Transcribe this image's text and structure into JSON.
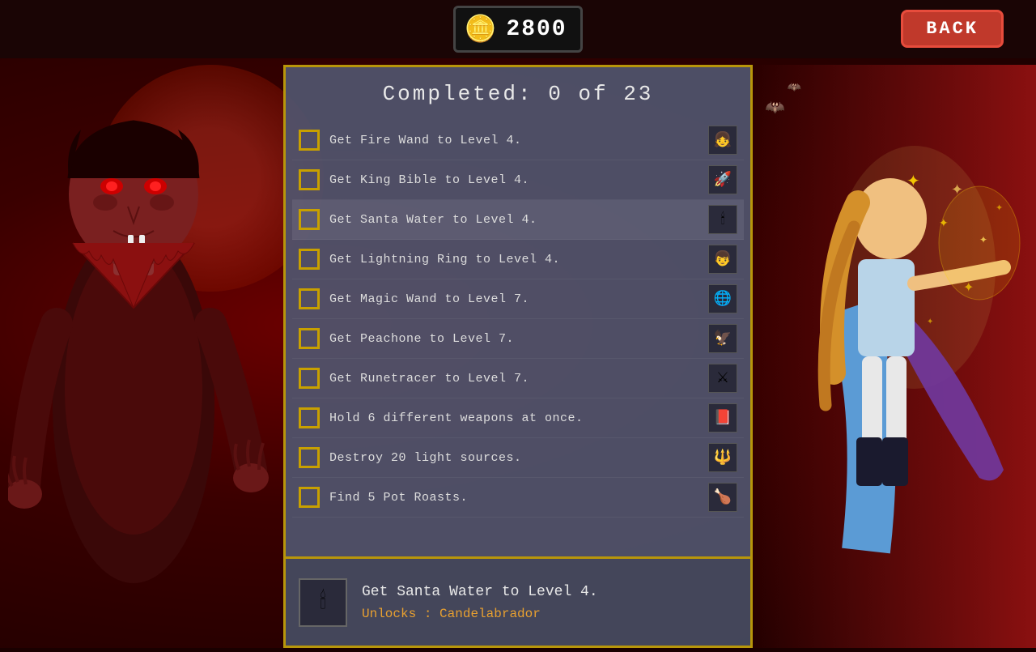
{
  "header": {
    "currency": "2800",
    "back_label": "BACK"
  },
  "panel": {
    "completed_text": "Completed: 0 of 23"
  },
  "achievements": [
    {
      "id": 1,
      "text": "Get Fire Wand to Level 4.",
      "icon": "👧",
      "completed": false
    },
    {
      "id": 2,
      "text": "Get King Bible to Level 4.",
      "icon": "🚀",
      "completed": false
    },
    {
      "id": 3,
      "text": "Get Santa Water to Level 4.",
      "icon": "🕯",
      "completed": false,
      "selected": true
    },
    {
      "id": 4,
      "text": "Get Lightning Ring to Level 4.",
      "icon": "👦",
      "completed": false
    },
    {
      "id": 5,
      "text": "Get Magic Wand to Level 7.",
      "icon": "🌐",
      "completed": false
    },
    {
      "id": 6,
      "text": "Get Peachone to Level 7.",
      "icon": "🦅",
      "completed": false
    },
    {
      "id": 7,
      "text": "Get Runetracer to Level 7.",
      "icon": "⚔",
      "completed": false
    },
    {
      "id": 8,
      "text": "Hold 6 different weapons at once.",
      "icon": "📕",
      "completed": false
    },
    {
      "id": 9,
      "text": "Destroy 20 light sources.",
      "icon": "🔱",
      "completed": false
    },
    {
      "id": 10,
      "text": "Find 5 Pot Roasts.",
      "icon": "🍗",
      "completed": false
    }
  ],
  "detail": {
    "icon": "🕯",
    "title": "Get Santa Water to Level 4.",
    "unlocks_label": "Unlocks :",
    "unlocks_value": "Candelabrador"
  }
}
